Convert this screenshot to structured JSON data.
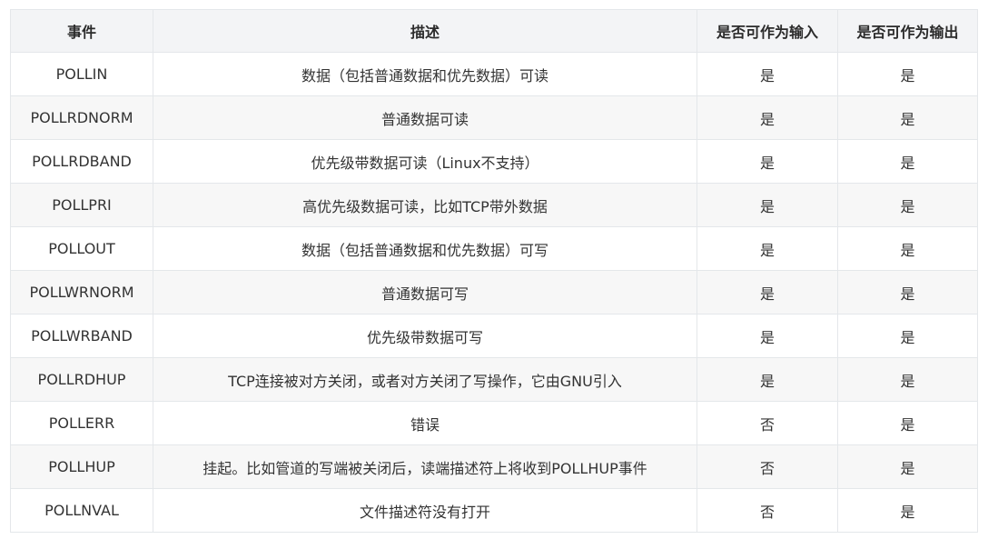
{
  "table": {
    "headers": [
      "事件",
      "描述",
      "是否可作为输入",
      "是否可作为输出"
    ],
    "rows": [
      [
        "POLLIN",
        "数据（包括普通数据和优先数据）可读",
        "是",
        "是"
      ],
      [
        "POLLRDNORM",
        "普通数据可读",
        "是",
        "是"
      ],
      [
        "POLLRDBAND",
        "优先级带数据可读（Linux不支持）",
        "是",
        "是"
      ],
      [
        "POLLPRI",
        "高优先级数据可读，比如TCP带外数据",
        "是",
        "是"
      ],
      [
        "POLLOUT",
        "数据（包括普通数据和优先数据）可写",
        "是",
        "是"
      ],
      [
        "POLLWRNORM",
        "普通数据可写",
        "是",
        "是"
      ],
      [
        "POLLWRBAND",
        "优先级带数据可写",
        "是",
        "是"
      ],
      [
        "POLLRDHUP",
        "TCP连接被对方关闭，或者对方关闭了写操作，它由GNU引入",
        "是",
        "是"
      ],
      [
        "POLLERR",
        "错误",
        "否",
        "是"
      ],
      [
        "POLLHUP",
        "挂起。比如管道的写端被关闭后，读端描述符上将收到POLLHUP事件",
        "否",
        "是"
      ],
      [
        "POLLNVAL",
        "文件描述符没有打开",
        "否",
        "是"
      ]
    ]
  }
}
